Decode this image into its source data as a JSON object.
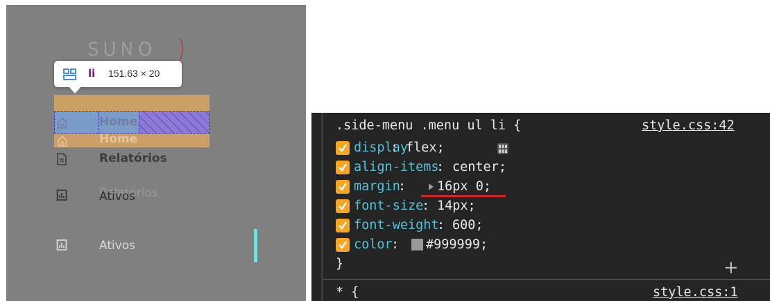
{
  "left_panel": {
    "logo_text": "SUNO",
    "tooltip": {
      "tag": "li",
      "size": "151.63 × 20"
    },
    "menu": {
      "home_label": "Home",
      "relatorios_label": "Relatórios",
      "ativos_label": "Ativos"
    }
  },
  "styles_pane": {
    "rule": {
      "selector": ".side-menu .menu ul li {",
      "source": "style.css:42",
      "declarations": [
        {
          "property": "display",
          "value": "flex;"
        },
        {
          "property": "align-items",
          "value": "center;"
        },
        {
          "property": "margin",
          "value": "16px 0;"
        },
        {
          "property": "font-size",
          "value": "14px;"
        },
        {
          "property": "font-weight",
          "value": "600;"
        },
        {
          "property": "color",
          "value": "#999999;"
        }
      ],
      "close": "}"
    },
    "next_rule": {
      "selector": "* {",
      "source": "style.css:1"
    },
    "add_symbol": "+"
  },
  "colors": {
    "margin_highlight": "#d1a266",
    "content_highlight": "#7a9cc8",
    "padding_highlight": "#8b7ad6",
    "property_name": "#4fc3d8",
    "checkbox": "#f5a623",
    "underline": "#d8232a",
    "swatch": "#999999",
    "scroll_indicator": "#79e2e0"
  },
  "icons": [
    "grid-layout-icon",
    "home-icon",
    "document-icon",
    "chart-icon",
    "flex-layout-icon",
    "checkbox-checked-icon",
    "expand-arrow-icon",
    "add-icon"
  ]
}
